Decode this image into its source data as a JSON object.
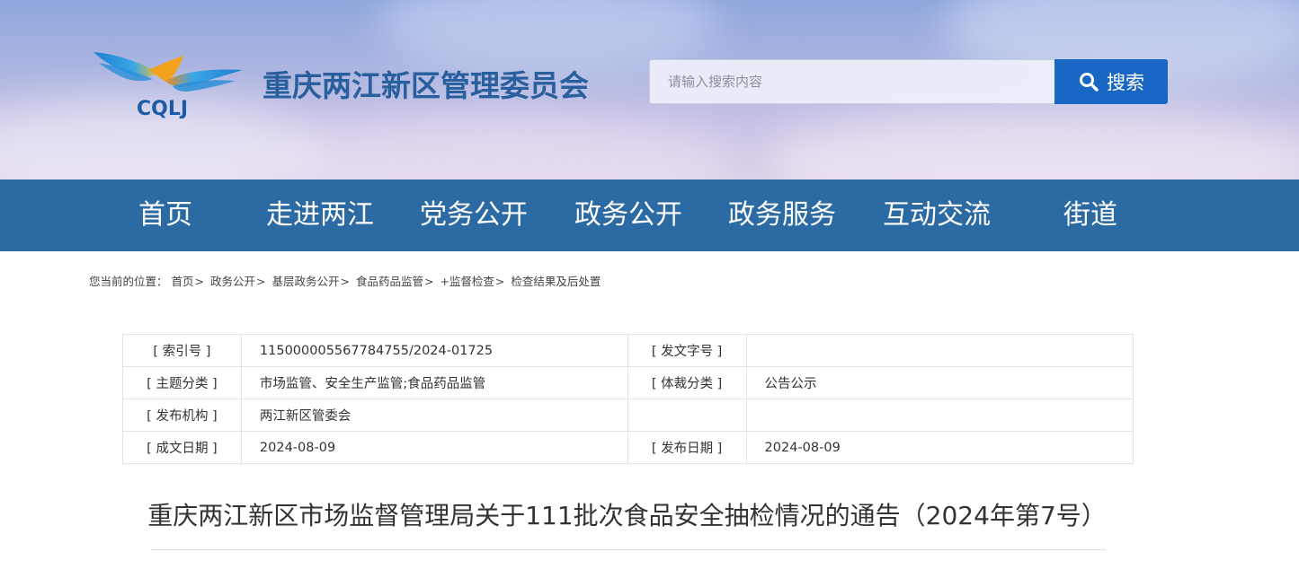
{
  "header": {
    "logo_text": "CQLJ",
    "site_title": "重庆两江新区管理委员会",
    "search": {
      "placeholder": "请输入搜索内容",
      "button_label": "搜索"
    }
  },
  "nav": {
    "items": [
      {
        "label": "首页"
      },
      {
        "label": "走进两江"
      },
      {
        "label": "党务公开"
      },
      {
        "label": "政务公开"
      },
      {
        "label": "政务服务"
      },
      {
        "label": "互动交流"
      },
      {
        "label": "街道"
      }
    ]
  },
  "breadcrumb": {
    "prefix": "您当前的位置：",
    "items": [
      "首页",
      "政务公开",
      "基层政务公开",
      "食品药品监管",
      "+监督检查",
      "检查结果及后处置"
    ],
    "separators": [
      ">",
      ">",
      ">",
      ">",
      ">"
    ]
  },
  "meta": {
    "rows": [
      {
        "label1": "[ 索引号 ]",
        "value1": "115000005567784755/2024-01725",
        "label2": "[ 发文字号 ]",
        "value2": ""
      },
      {
        "label1": "[ 主题分类 ]",
        "value1": "市场监管、安全生产监管;食品药品监管",
        "label2": "[ 体裁分类 ]",
        "value2": "公告公示"
      },
      {
        "label1": "[ 发布机构 ]",
        "value1": "两江新区管委会",
        "label2": "",
        "value2": ""
      },
      {
        "label1": "[ 成文日期 ]",
        "value1": "2024-08-09",
        "label2": "[ 发布日期 ]",
        "value2": "2024-08-09"
      }
    ]
  },
  "article": {
    "title": "重庆两江新区市场监督管理局关于111批次食品安全抽检情况的通告（2024年第7号）"
  },
  "colors": {
    "nav_bg": "#2c6aa3",
    "search_button": "#1967c4",
    "site_title": "#2a5f9e"
  }
}
